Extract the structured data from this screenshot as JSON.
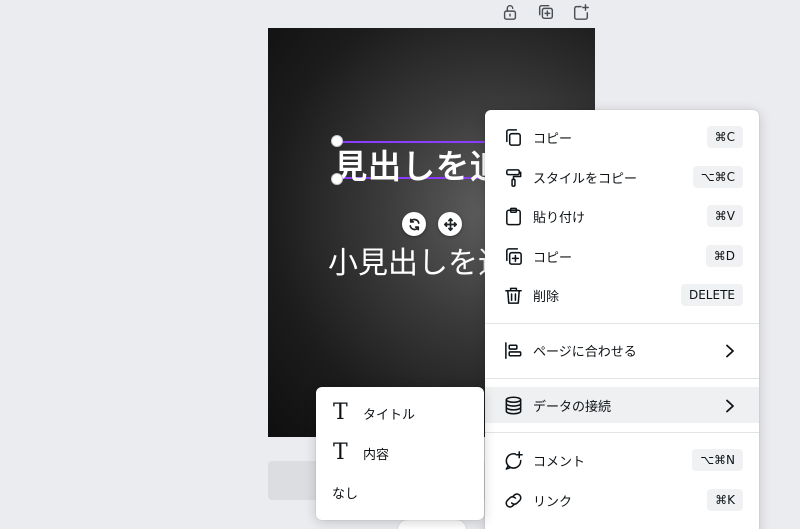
{
  "toolbar": {
    "icons": [
      "lock-icon",
      "duplicate-page-icon",
      "add-page-icon"
    ]
  },
  "canvas": {
    "heading": "見出しを追加",
    "subheading": "小見出しを追加"
  },
  "context_menu": {
    "items": [
      {
        "label": "コピー",
        "shortcut": "⌘C",
        "icon": "copy-icon"
      },
      {
        "label": "スタイルをコピー",
        "shortcut": "⌥⌘C",
        "icon": "paint-roller-icon"
      },
      {
        "label": "貼り付け",
        "shortcut": "⌘V",
        "icon": "clipboard-icon"
      },
      {
        "label": "コピー",
        "shortcut": "⌘D",
        "icon": "duplicate-icon"
      },
      {
        "label": "削除",
        "shortcut": "DELETE",
        "icon": "trash-icon"
      },
      {
        "label": "ページに合わせる",
        "icon": "align-to-page-icon"
      },
      {
        "label": "データの接続",
        "icon": "database-icon"
      },
      {
        "label": "コメント",
        "shortcut": "⌥⌘N",
        "icon": "comment-icon"
      },
      {
        "label": "リンク",
        "shortcut": "⌘K",
        "icon": "link-icon"
      }
    ]
  },
  "submenu": {
    "items": [
      {
        "label": "タイトル",
        "icon": "text-icon"
      },
      {
        "label": "内容",
        "icon": "text-icon"
      },
      {
        "label": "なし"
      }
    ],
    "text_glyph": "T"
  },
  "colors": {
    "selection": "#8b3dff",
    "background": "#ebecf0",
    "menu_hover": "#eff0f2"
  }
}
